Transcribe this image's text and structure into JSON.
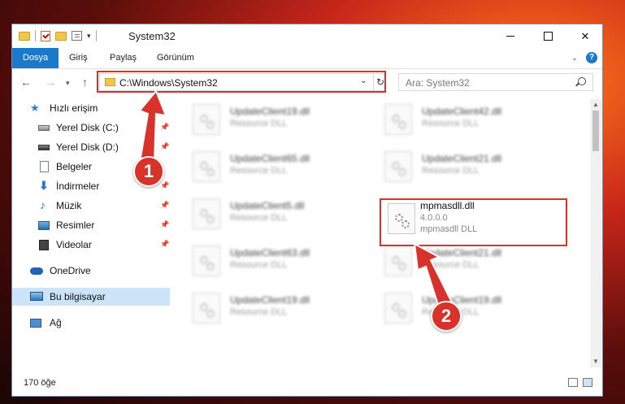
{
  "title_bar": {
    "title": "System32"
  },
  "ribbon": {
    "tabs": [
      "Dosya",
      "Giriş",
      "Paylaş",
      "Görünüm"
    ]
  },
  "address_bar": {
    "path": "C:\\Windows\\System32"
  },
  "search": {
    "placeholder": "Ara: System32"
  },
  "sidebar": {
    "items": [
      {
        "label": "Hızlı erişim"
      },
      {
        "label": "Yerel Disk (C:)"
      },
      {
        "label": "Yerel Disk (D:)"
      },
      {
        "label": "Belgeler"
      },
      {
        "label": "İndirmeler"
      },
      {
        "label": "Müzik"
      },
      {
        "label": "Resimler"
      },
      {
        "label": "Videolar"
      },
      {
        "label": "OneDrive"
      },
      {
        "label": "Bu bilgisayar"
      },
      {
        "label": "Ağ"
      }
    ]
  },
  "files": {
    "left_column": [
      {
        "name": "UpdateClient19.dll",
        "desc": "Resource DLL"
      },
      {
        "name": "UpdateClient65.dll",
        "desc": "Resource DLL"
      },
      {
        "name": "UpdateClient5.dll",
        "desc": "Resource DLL"
      },
      {
        "name": "UpdateClient63.dll",
        "desc": "Resource DLL"
      },
      {
        "name": "UpdateClient19.dll",
        "desc": "Resource DLL"
      }
    ],
    "right_column": [
      {
        "name": "UpdateClient42.dll",
        "desc": "Resource DLL"
      },
      {
        "name": "UpdateClient21.dll",
        "desc": "Resource DLL"
      },
      {
        "name": "UpdateClient21.dll",
        "desc": "Resource DLL"
      },
      {
        "name": "UpdateClient19.dll",
        "desc": "Resource DLL"
      }
    ],
    "highlighted": {
      "name": "mpmasdll.dll",
      "version": "4.0.0.0",
      "desc": "mpmasdll DLL"
    }
  },
  "status": {
    "item_count": "170 öğe"
  },
  "annotations": {
    "step1": "1",
    "step2": "2"
  },
  "colors": {
    "accent": "#1979ca",
    "highlight": "#d9322a",
    "selected_nav": "#cce4f7"
  }
}
